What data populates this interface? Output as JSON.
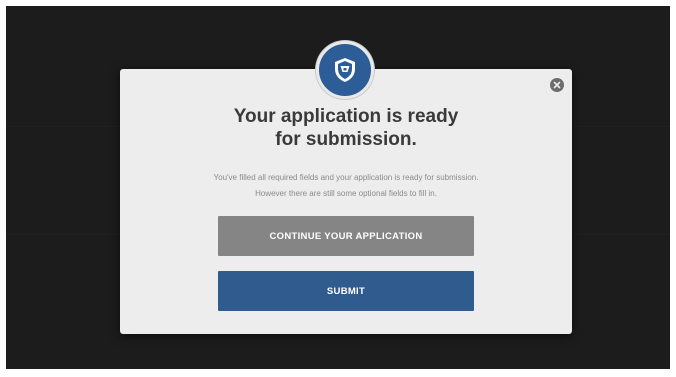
{
  "modal": {
    "title_line1": "Your application is ready",
    "title_line2": "for submission.",
    "description_line1": "You've filled all required fields and your application is ready for submission.",
    "description_line2": "However there are still some optional fields to fill in.",
    "continue_label": "CONTINUE YOUR APPLICATION",
    "submit_label": "SUBMIT",
    "badge_icon": "shield-icon",
    "close_icon": "close-icon"
  },
  "colors": {
    "backdrop": "#1c1c1c",
    "modal_bg": "#ededed",
    "brand_blue": "#2c5d96",
    "continue_button": "#858585",
    "submit_button": "#2f5b8e",
    "title_text": "#3a3a3a",
    "body_text": "#8a8a8a"
  }
}
